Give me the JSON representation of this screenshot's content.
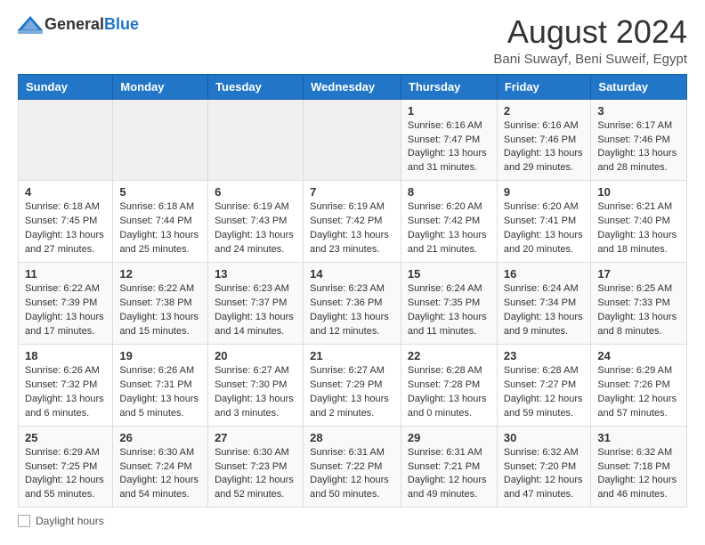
{
  "logo": {
    "general": "General",
    "blue": "Blue"
  },
  "title": "August 2024",
  "subtitle": "Bani Suwayf, Beni Suweif, Egypt",
  "days_of_week": [
    "Sunday",
    "Monday",
    "Tuesday",
    "Wednesday",
    "Thursday",
    "Friday",
    "Saturday"
  ],
  "weeks": [
    [
      {
        "day": "",
        "info": ""
      },
      {
        "day": "",
        "info": ""
      },
      {
        "day": "",
        "info": ""
      },
      {
        "day": "",
        "info": ""
      },
      {
        "day": "1",
        "info": "Sunrise: 6:16 AM\nSunset: 7:47 PM\nDaylight: 13 hours and 31 minutes."
      },
      {
        "day": "2",
        "info": "Sunrise: 6:16 AM\nSunset: 7:46 PM\nDaylight: 13 hours and 29 minutes."
      },
      {
        "day": "3",
        "info": "Sunrise: 6:17 AM\nSunset: 7:46 PM\nDaylight: 13 hours and 28 minutes."
      }
    ],
    [
      {
        "day": "4",
        "info": "Sunrise: 6:18 AM\nSunset: 7:45 PM\nDaylight: 13 hours and 27 minutes."
      },
      {
        "day": "5",
        "info": "Sunrise: 6:18 AM\nSunset: 7:44 PM\nDaylight: 13 hours and 25 minutes."
      },
      {
        "day": "6",
        "info": "Sunrise: 6:19 AM\nSunset: 7:43 PM\nDaylight: 13 hours and 24 minutes."
      },
      {
        "day": "7",
        "info": "Sunrise: 6:19 AM\nSunset: 7:42 PM\nDaylight: 13 hours and 23 minutes."
      },
      {
        "day": "8",
        "info": "Sunrise: 6:20 AM\nSunset: 7:42 PM\nDaylight: 13 hours and 21 minutes."
      },
      {
        "day": "9",
        "info": "Sunrise: 6:20 AM\nSunset: 7:41 PM\nDaylight: 13 hours and 20 minutes."
      },
      {
        "day": "10",
        "info": "Sunrise: 6:21 AM\nSunset: 7:40 PM\nDaylight: 13 hours and 18 minutes."
      }
    ],
    [
      {
        "day": "11",
        "info": "Sunrise: 6:22 AM\nSunset: 7:39 PM\nDaylight: 13 hours and 17 minutes."
      },
      {
        "day": "12",
        "info": "Sunrise: 6:22 AM\nSunset: 7:38 PM\nDaylight: 13 hours and 15 minutes."
      },
      {
        "day": "13",
        "info": "Sunrise: 6:23 AM\nSunset: 7:37 PM\nDaylight: 13 hours and 14 minutes."
      },
      {
        "day": "14",
        "info": "Sunrise: 6:23 AM\nSunset: 7:36 PM\nDaylight: 13 hours and 12 minutes."
      },
      {
        "day": "15",
        "info": "Sunrise: 6:24 AM\nSunset: 7:35 PM\nDaylight: 13 hours and 11 minutes."
      },
      {
        "day": "16",
        "info": "Sunrise: 6:24 AM\nSunset: 7:34 PM\nDaylight: 13 hours and 9 minutes."
      },
      {
        "day": "17",
        "info": "Sunrise: 6:25 AM\nSunset: 7:33 PM\nDaylight: 13 hours and 8 minutes."
      }
    ],
    [
      {
        "day": "18",
        "info": "Sunrise: 6:26 AM\nSunset: 7:32 PM\nDaylight: 13 hours and 6 minutes."
      },
      {
        "day": "19",
        "info": "Sunrise: 6:26 AM\nSunset: 7:31 PM\nDaylight: 13 hours and 5 minutes."
      },
      {
        "day": "20",
        "info": "Sunrise: 6:27 AM\nSunset: 7:30 PM\nDaylight: 13 hours and 3 minutes."
      },
      {
        "day": "21",
        "info": "Sunrise: 6:27 AM\nSunset: 7:29 PM\nDaylight: 13 hours and 2 minutes."
      },
      {
        "day": "22",
        "info": "Sunrise: 6:28 AM\nSunset: 7:28 PM\nDaylight: 13 hours and 0 minutes."
      },
      {
        "day": "23",
        "info": "Sunrise: 6:28 AM\nSunset: 7:27 PM\nDaylight: 12 hours and 59 minutes."
      },
      {
        "day": "24",
        "info": "Sunrise: 6:29 AM\nSunset: 7:26 PM\nDaylight: 12 hours and 57 minutes."
      }
    ],
    [
      {
        "day": "25",
        "info": "Sunrise: 6:29 AM\nSunset: 7:25 PM\nDaylight: 12 hours and 55 minutes."
      },
      {
        "day": "26",
        "info": "Sunrise: 6:30 AM\nSunset: 7:24 PM\nDaylight: 12 hours and 54 minutes."
      },
      {
        "day": "27",
        "info": "Sunrise: 6:30 AM\nSunset: 7:23 PM\nDaylight: 12 hours and 52 minutes."
      },
      {
        "day": "28",
        "info": "Sunrise: 6:31 AM\nSunset: 7:22 PM\nDaylight: 12 hours and 50 minutes."
      },
      {
        "day": "29",
        "info": "Sunrise: 6:31 AM\nSunset: 7:21 PM\nDaylight: 12 hours and 49 minutes."
      },
      {
        "day": "30",
        "info": "Sunrise: 6:32 AM\nSunset: 7:20 PM\nDaylight: 12 hours and 47 minutes."
      },
      {
        "day": "31",
        "info": "Sunrise: 6:32 AM\nSunset: 7:18 PM\nDaylight: 12 hours and 46 minutes."
      }
    ]
  ],
  "footer": {
    "daylight_label": "Daylight hours"
  }
}
